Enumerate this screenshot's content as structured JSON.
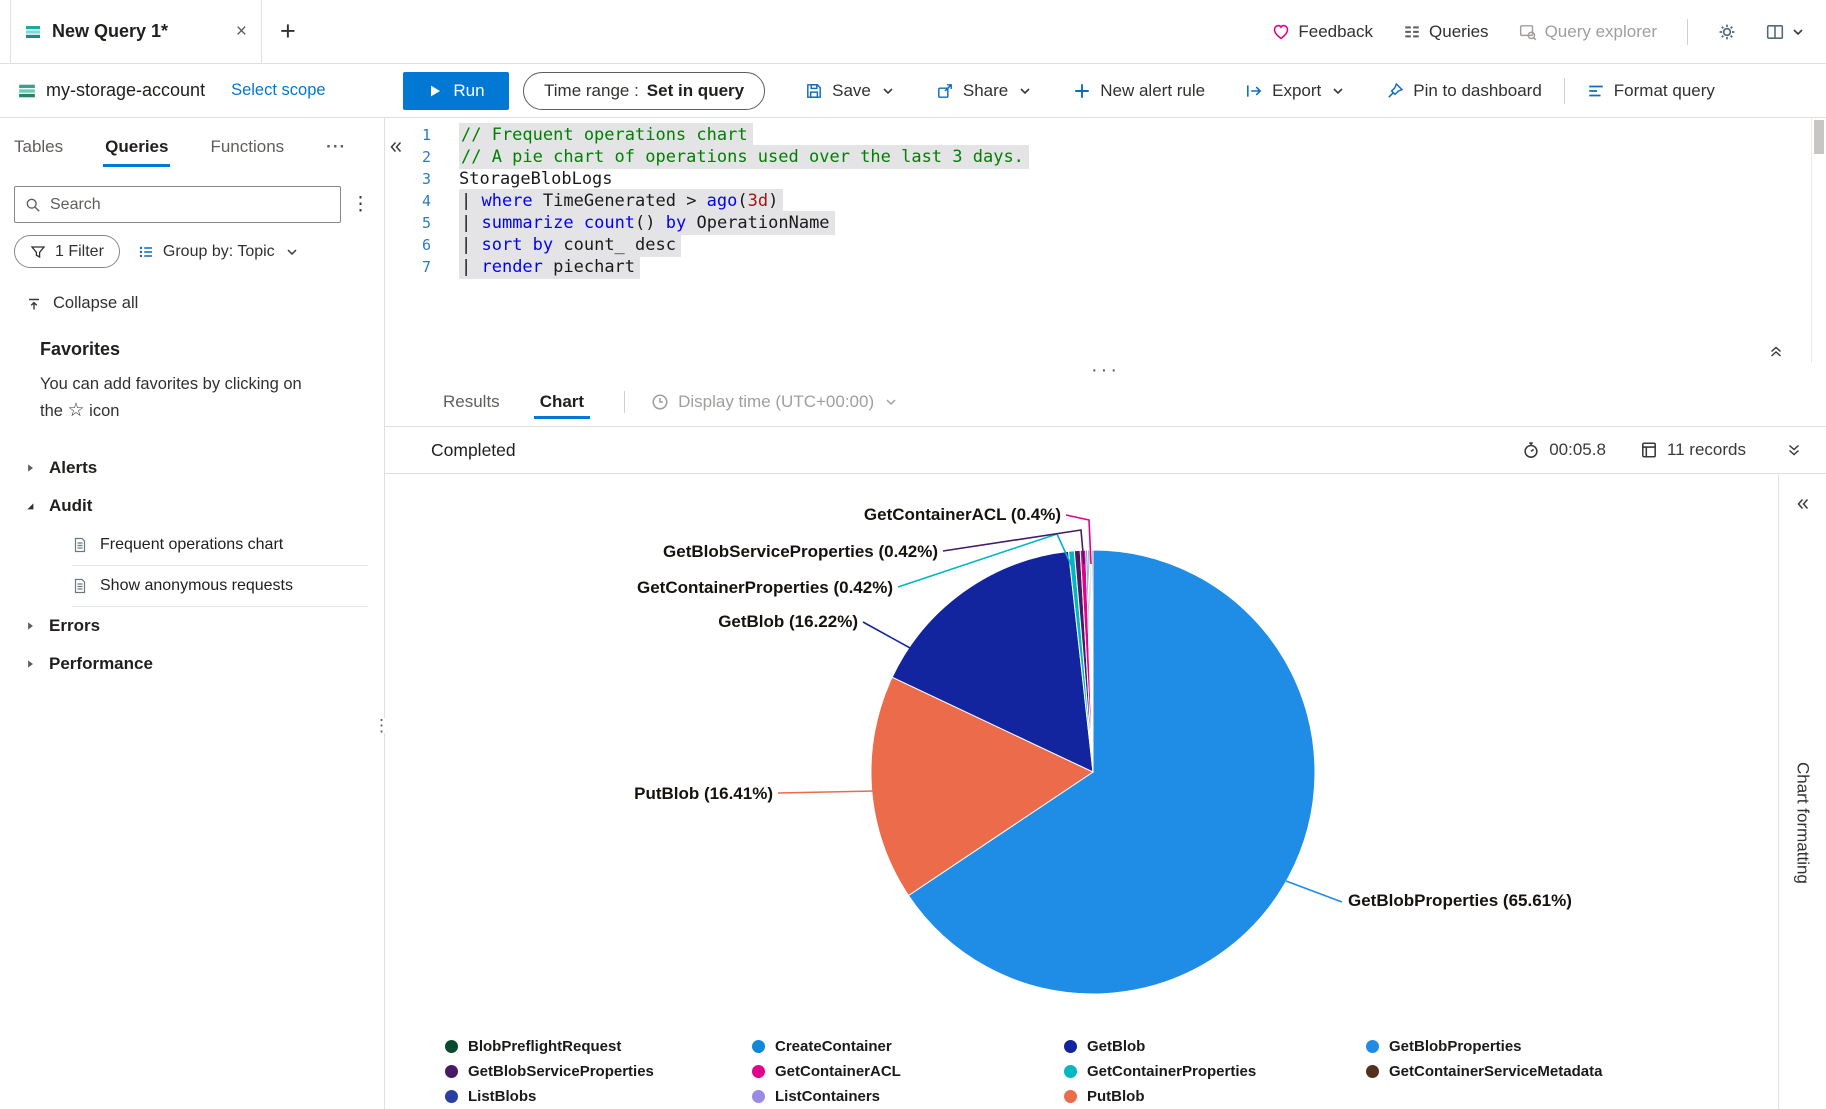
{
  "window": {
    "tab_title": "New Query 1*",
    "top_right": {
      "feedback": "Feedback",
      "queries": "Queries",
      "query_explorer": "Query explorer"
    }
  },
  "toolbar": {
    "scope_name": "my-storage-account",
    "select_scope": "Select scope",
    "run_label": "Run",
    "time_range_label": "Time range :",
    "time_range_value": "Set in query",
    "save_label": "Save",
    "share_label": "Share",
    "new_alert_rule_label": "New alert rule",
    "export_label": "Export",
    "pin_label": "Pin to dashboard",
    "format_label": "Format query"
  },
  "sidebar": {
    "tabs": [
      {
        "label": "Tables",
        "active": false
      },
      {
        "label": "Queries",
        "active": true
      },
      {
        "label": "Functions",
        "active": false
      }
    ],
    "search_placeholder": "Search",
    "filter_pill": "1 Filter",
    "group_by": "Group by: Topic",
    "collapse_all": "Collapse all",
    "favorites_title": "Favorites",
    "favorites_hint_line1": "You can add favorites by clicking on",
    "favorites_hint_line2_pre": "the",
    "favorites_hint_star": "☆",
    "favorites_hint_line2_post": "icon",
    "tree": [
      {
        "label": "Alerts",
        "expanded": false,
        "children": []
      },
      {
        "label": "Audit",
        "expanded": true,
        "children": [
          "Frequent operations chart",
          "Show anonymous requests"
        ]
      },
      {
        "label": "Errors",
        "expanded": false,
        "children": []
      },
      {
        "label": "Performance",
        "expanded": false,
        "children": []
      }
    ]
  },
  "editor": {
    "lines": [
      {
        "n": 1,
        "hl": true,
        "tokens": [
          {
            "c": "cm",
            "t": "// Frequent operations chart"
          }
        ]
      },
      {
        "n": 2,
        "hl": true,
        "tokens": [
          {
            "c": "cm",
            "t": "// A pie chart of operations used over the last 3 days."
          }
        ]
      },
      {
        "n": 3,
        "hl": false,
        "tokens": [
          {
            "c": "pl",
            "t": "StorageBlobLogs"
          }
        ]
      },
      {
        "n": 4,
        "hl": true,
        "tokens": [
          {
            "c": "pl",
            "t": "| "
          },
          {
            "c": "kw",
            "t": "where"
          },
          {
            "c": "pl",
            "t": " TimeGenerated > "
          },
          {
            "c": "kw",
            "t": "ago"
          },
          {
            "c": "pl",
            "t": "("
          },
          {
            "c": "num",
            "t": "3d"
          },
          {
            "c": "pl",
            "t": ")"
          }
        ]
      },
      {
        "n": 5,
        "hl": true,
        "tokens": [
          {
            "c": "pl",
            "t": "| "
          },
          {
            "c": "kw",
            "t": "summarize"
          },
          {
            "c": "pl",
            "t": " "
          },
          {
            "c": "kw",
            "t": "count"
          },
          {
            "c": "pl",
            "t": "() "
          },
          {
            "c": "kw",
            "t": "by"
          },
          {
            "c": "pl",
            "t": " OperationName"
          }
        ]
      },
      {
        "n": 6,
        "hl": true,
        "tokens": [
          {
            "c": "pl",
            "t": "| "
          },
          {
            "c": "kw",
            "t": "sort by"
          },
          {
            "c": "pl",
            "t": " count_ desc"
          }
        ]
      },
      {
        "n": 7,
        "hl": true,
        "tokens": [
          {
            "c": "pl",
            "t": "| "
          },
          {
            "c": "kw",
            "t": "render"
          },
          {
            "c": "pl",
            "t": " piechart"
          }
        ]
      }
    ]
  },
  "results": {
    "tab_results": "Results",
    "tab_chart": "Chart",
    "display_time": "Display time (UTC+00:00)",
    "status": "Completed",
    "duration": "00:05.8",
    "record_count": "11 records"
  },
  "chart_panel": {
    "formatting_label": "Chart formatting"
  },
  "chart_data": {
    "type": "pie",
    "legend_position": "bottom",
    "slices": [
      {
        "name": "GetBlobProperties",
        "pct": 65.61,
        "color": "#1f8ce6",
        "label": "GetBlobProperties (65.61%)"
      },
      {
        "name": "PutBlob",
        "pct": 16.41,
        "color": "#eb6b4b",
        "label": "PutBlob (16.41%)"
      },
      {
        "name": "GetBlob",
        "pct": 16.22,
        "color": "#12259e",
        "label": "GetBlob (16.22%)"
      },
      {
        "name": "GetContainerProperties",
        "pct": 0.42,
        "color": "#00b7c3",
        "label": "GetContainerProperties (0.42%)"
      },
      {
        "name": "GetBlobServiceProperties",
        "pct": 0.42,
        "color": "#471a67",
        "label": "GetBlobServiceProperties (0.42%)"
      },
      {
        "name": "GetContainerACL",
        "pct": 0.4,
        "color": "#e3008c",
        "label": "GetContainerACL (0.4%)"
      },
      {
        "name": "CreateContainer",
        "pct": 0.13,
        "color": "#1287d8"
      },
      {
        "name": "BlobPreflightRequest",
        "pct": 0.11,
        "color": "#0b4a31"
      },
      {
        "name": "ListBlobs",
        "pct": 0.1,
        "color": "#2a3f9f"
      },
      {
        "name": "ListContainers",
        "pct": 0.09,
        "color": "#9b8ae6"
      },
      {
        "name": "GetContainerServiceMetadata",
        "pct": 0.09,
        "color": "#54301f"
      }
    ],
    "legend_columns": [
      [
        "BlobPreflightRequest",
        "GetBlobServiceProperties",
        "ListBlobs"
      ],
      [
        "CreateContainer",
        "GetContainerACL",
        "ListContainers"
      ],
      [
        "GetBlob",
        "GetContainerProperties",
        "PutBlob"
      ],
      [
        "GetBlobProperties",
        "GetContainerServiceMetadata"
      ]
    ]
  }
}
